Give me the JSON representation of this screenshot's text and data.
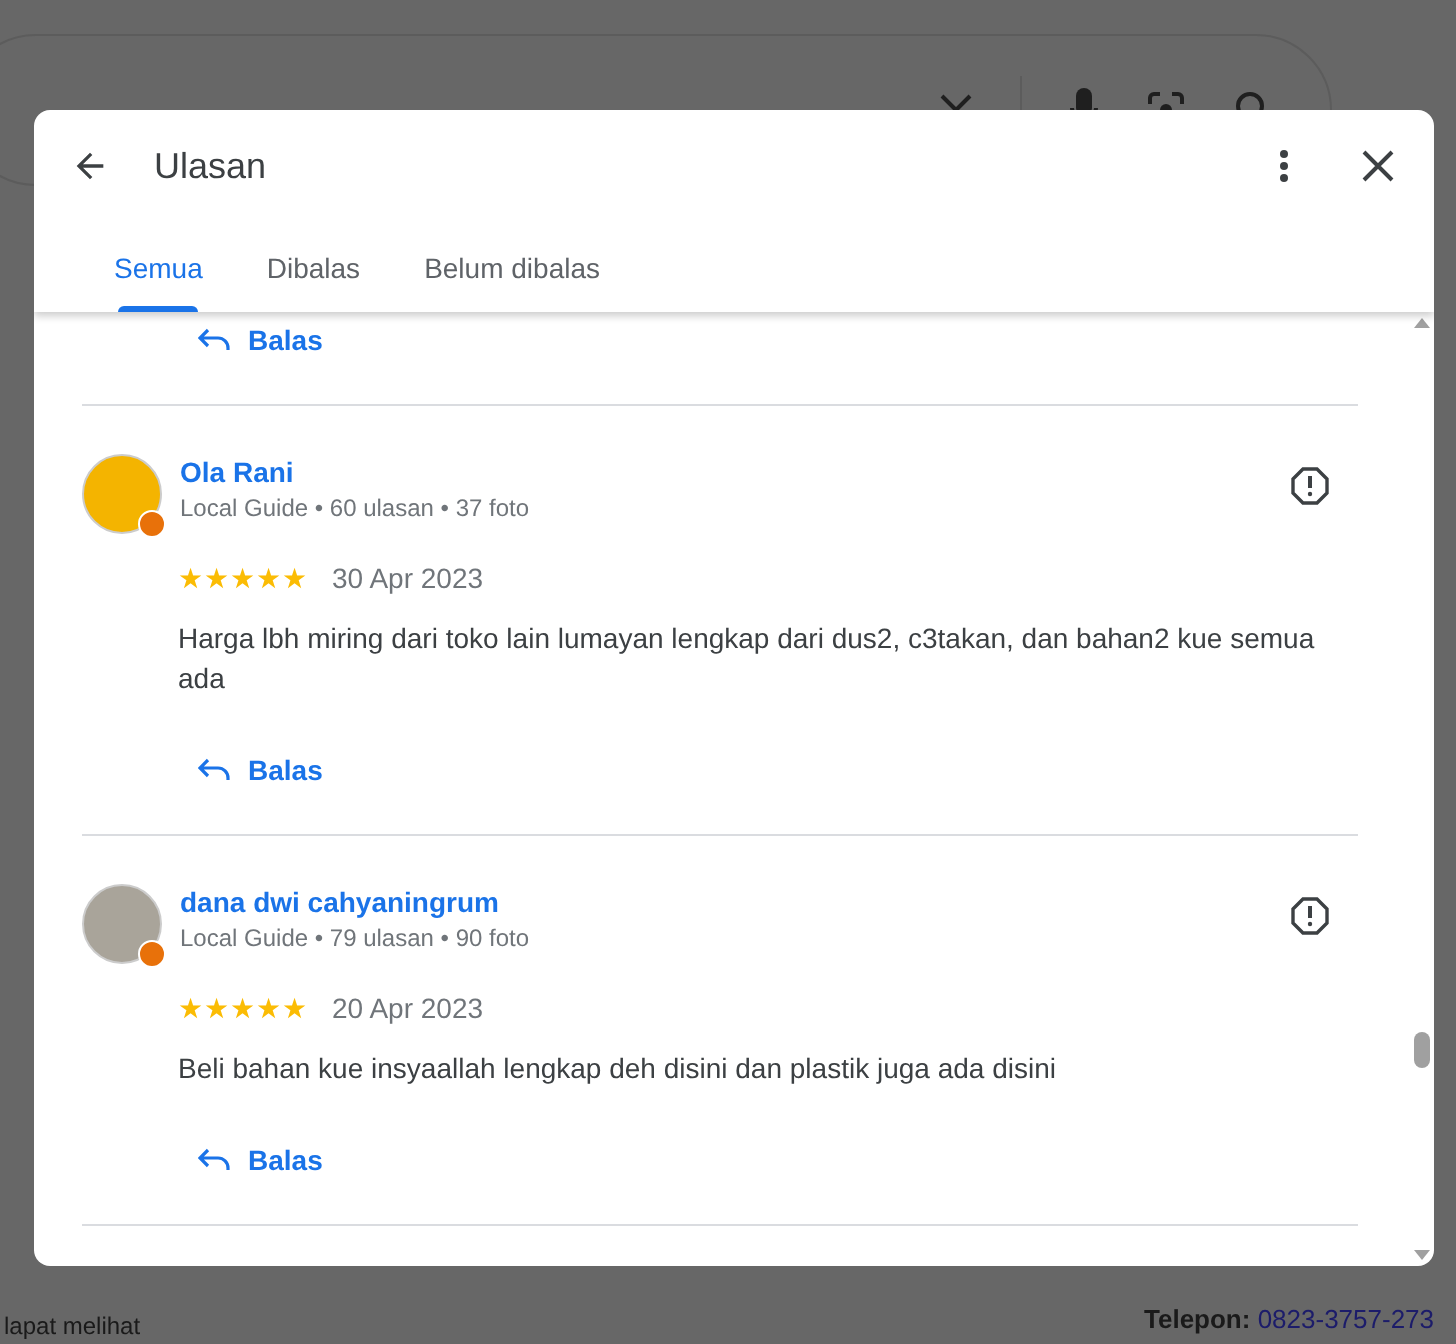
{
  "background": {
    "phone_label": "Telepon:",
    "phone_value": "0823-3757-273",
    "footer_fragment": "lapat melihat"
  },
  "dialog": {
    "title": "Ulasan",
    "tabs": [
      {
        "label": "Semua",
        "selected": true
      },
      {
        "label": "Dibalas",
        "selected": false
      },
      {
        "label": "Belum dibalas",
        "selected": false
      }
    ],
    "previous_reply": "Balas",
    "reviews": [
      {
        "name": "Ola Rani",
        "meta": "Local Guide • 60 ulasan • 37 foto",
        "stars": 5,
        "date": "30 Apr 2023",
        "text": "Harga lbh miring dari toko lain lumayan lengkap dari dus2, c3takan, dan bahan2 kue semua ada",
        "reply": "Balas"
      },
      {
        "name": "dana dwi cahyaningrum",
        "meta": "Local Guide • 79 ulasan • 90 foto",
        "stars": 5,
        "date": "20 Apr 2023",
        "text": "Beli bahan kue insyaallah lengkap deh disini dan plastik juga ada disini",
        "reply": "Balas"
      }
    ]
  }
}
